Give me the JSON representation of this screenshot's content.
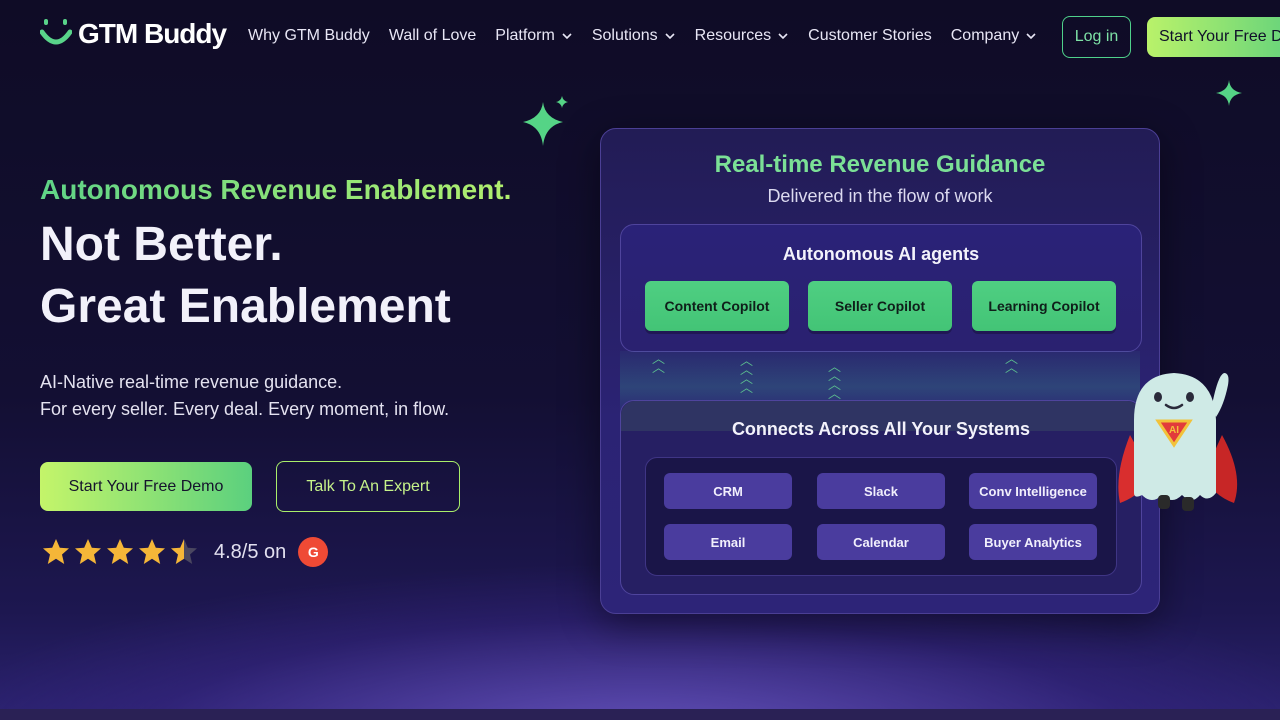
{
  "nav": {
    "logo_text": "GTM Buddy",
    "items": [
      {
        "label": "Why GTM Buddy",
        "dropdown": false
      },
      {
        "label": "Wall of Love",
        "dropdown": false
      },
      {
        "label": "Platform",
        "dropdown": true
      },
      {
        "label": "Solutions",
        "dropdown": true
      },
      {
        "label": "Resources",
        "dropdown": true
      },
      {
        "label": "Customer Stories",
        "dropdown": false
      },
      {
        "label": "Company",
        "dropdown": true
      }
    ],
    "login_label": "Log in",
    "demo_label": "Start Your Free Demo"
  },
  "hero": {
    "eyebrow": "Autonomous Revenue Enablement.",
    "title_line1": "Not Better.",
    "title_line2": "Great Enablement",
    "sub_line1": "AI-Native real-time revenue guidance.",
    "sub_line2": "For every seller. Every deal. Every moment, in flow.",
    "cta_primary": "Start Your Free Demo",
    "cta_secondary": "Talk To An Expert",
    "rating_text": "4.8/5 on",
    "rating_stars": 4.5,
    "g2_badge": "G"
  },
  "card": {
    "title": "Real-time Revenue Guidance",
    "subtitle": "Delivered in the flow of work",
    "agents_title": "Autonomous AI agents",
    "agents": [
      "Content Copilot",
      "Seller Copilot",
      "Learning Copilot"
    ],
    "systems_title": "Connects Across All Your Systems",
    "systems": [
      "CRM",
      "Slack",
      "Conv Intelligence",
      "Email",
      "Calendar",
      "Buyer Analytics"
    ]
  },
  "mascot": {
    "badge": "AI"
  },
  "colors": {
    "accent_green": "#4fcf82",
    "accent_lime": "#b9f26a",
    "background": "#130f33",
    "card": "#2b2374",
    "chip": "#4a3c9e"
  }
}
